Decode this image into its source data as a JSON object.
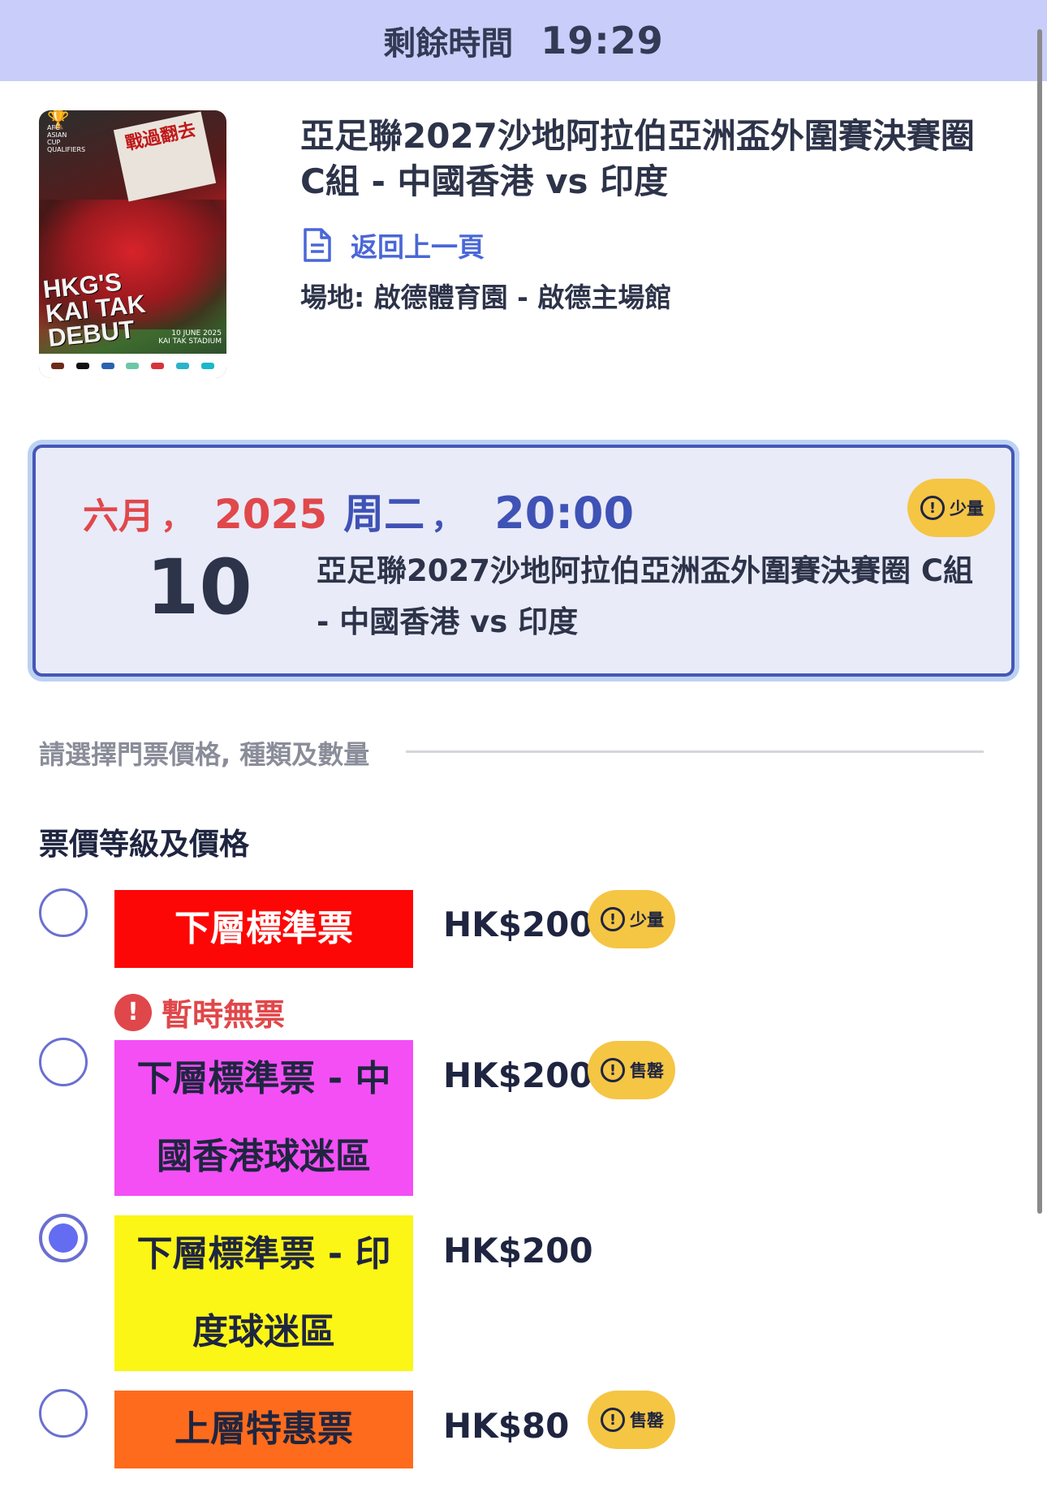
{
  "timer": {
    "label": "剩餘時間",
    "value": "19:29"
  },
  "event": {
    "title": "亞足聯2027沙地阿拉伯亞洲盃外圍賽決賽圈 C組 - 中國香港 vs 印度",
    "back_label": "返回上一頁",
    "venue": "場地: 啟德體育園 - 啟德主場館"
  },
  "poster": {
    "cup_caption": "AFC ASIAN CUP QUALIFIERS",
    "banner_text": "戰過翻去",
    "headline": [
      "HKG'S",
      "KAI TAK",
      "DEBUT"
    ],
    "date_text": [
      "10 JUNE 2025",
      "KAI TAK STADIUM"
    ]
  },
  "session": {
    "month": "六月",
    "comma": "，",
    "year": "2025",
    "weekday": "周二",
    "time": "20:00",
    "day": "10",
    "name": "亞足聯2027沙地阿拉伯亞洲盃外圍賽決賽圈 C組 - 中國香港 vs 印度",
    "badge": "少量"
  },
  "selection": {
    "hint": "請選擇門票價格, 種類及數量",
    "section_title": "票價等級及價格"
  },
  "tickets": [
    {
      "label": "下層標準票",
      "price": "HK$200",
      "badge": "少量",
      "color": "#fd0606",
      "selected": false
    },
    {
      "label": "下層標準票 - 中國香港球迷區",
      "price": "HK$200",
      "badge": "售罄",
      "color": "#f34ff5",
      "selected": false,
      "notice": "暫時無票"
    },
    {
      "label": "下層標準票 - 印度球迷區",
      "price": "HK$200",
      "badge": "",
      "color": "#fbf616",
      "selected": true
    },
    {
      "label": "上層特惠票",
      "price": "HK$80",
      "badge": "售罄",
      "color": "#fe6b1c",
      "selected": false
    }
  ],
  "icons": {
    "badge_icon": "exclamation-circle-icon",
    "back_icon": "document-icon",
    "notice_icon": "alert-circle-icon"
  },
  "colors": {
    "timer_bg": "#c9cdf9",
    "accent_blue": "#3f52b5",
    "accent_red": "#e0484b",
    "badge_yellow": "#f5c544",
    "radio_selected": "#646cf2"
  }
}
